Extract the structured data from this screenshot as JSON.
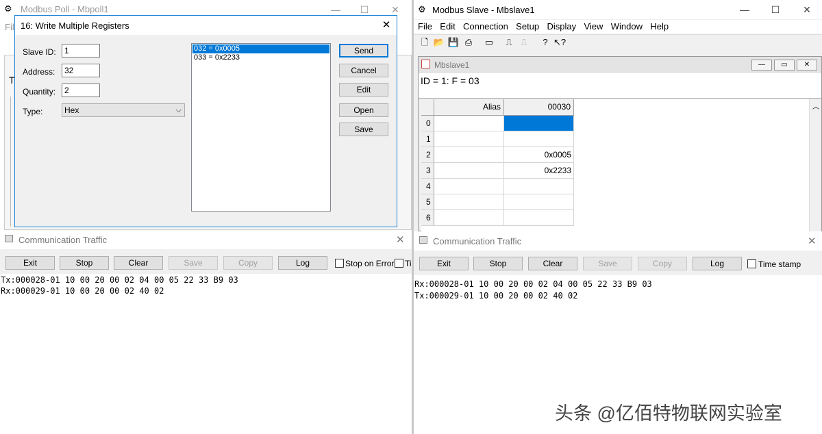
{
  "poll": {
    "title": "Modbus Poll - Mbpoll1",
    "menu_partial": "File",
    "traffic": {
      "title": "Communication Traffic",
      "buttons": {
        "exit": "Exit",
        "stop": "Stop",
        "clear": "Clear",
        "save": "Save",
        "copy": "Copy",
        "log": "Log"
      },
      "stop_on_error": "Stop on Error",
      "time_partial": "Ti",
      "lines": [
        "Tx:000028-01 10 00 20 00 02 04 00 05 22 33 B9 03",
        "Rx:000029-01 10 00 20 00 02 40 02"
      ]
    },
    "behind_text": "T"
  },
  "dialog": {
    "title": "16: Write Multiple Registers",
    "slave_id_label": "Slave ID:",
    "slave_id": "1",
    "address_label": "Address:",
    "address": "32",
    "quantity_label": "Quantity:",
    "quantity": "2",
    "type_label": "Type:",
    "type_value": "Hex",
    "registers": [
      "032 = 0x0005",
      "033 = 0x2233"
    ],
    "buttons": {
      "send": "Send",
      "cancel": "Cancel",
      "edit": "Edit",
      "open": "Open",
      "save": "Save"
    }
  },
  "slave": {
    "title": "Modbus Slave - Mbslave1",
    "menu": [
      "File",
      "Edit",
      "Connection",
      "Setup",
      "Display",
      "View",
      "Window",
      "Help"
    ],
    "child": {
      "title": "Mbslave1",
      "info": "ID = 1: F = 03",
      "columns": [
        "Alias",
        "00030"
      ],
      "rows": [
        {
          "idx": "0",
          "alias": "",
          "value": ""
        },
        {
          "idx": "1",
          "alias": "",
          "value": ""
        },
        {
          "idx": "2",
          "alias": "",
          "value": "0x0005"
        },
        {
          "idx": "3",
          "alias": "",
          "value": "0x2233"
        },
        {
          "idx": "4",
          "alias": "",
          "value": ""
        },
        {
          "idx": "5",
          "alias": "",
          "value": ""
        },
        {
          "idx": "6",
          "alias": "",
          "value": ""
        }
      ]
    },
    "traffic": {
      "title": "Communication Traffic",
      "buttons": {
        "exit": "Exit",
        "stop": "Stop",
        "clear": "Clear",
        "save": "Save",
        "copy": "Copy",
        "log": "Log"
      },
      "time_stamp": "Time stamp",
      "lines": [
        "Rx:000028-01 10 00 20 00 02 04 00 05 22 33 B9 03",
        "Tx:000029-01 10 00 20 00 02 40 02"
      ]
    }
  },
  "watermark": "头条 @亿佰特物联网实验室",
  "colors": {
    "selection": "#0078d7",
    "dialog_border": "#1883d7"
  }
}
